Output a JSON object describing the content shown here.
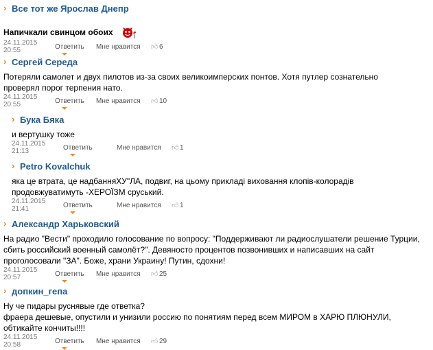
{
  "comments": [
    {
      "author": "Все тот же Ярослав Днепр",
      "text": "Напичкали свинцом обоих",
      "date": "24.11.2015 20:55",
      "reply": "Ответить",
      "like": "Мне нравится",
      "count": "6"
    },
    {
      "author": "Сергей Середа",
      "text": "Потеряли самолет и двух пилотов из-за своих великоимперских понтов. Хотя путлер сознательно проверял порог терпения нато.",
      "date": "24.11.2015 20:55",
      "reply": "Ответить",
      "like": "Мне нравится",
      "count": "10"
    },
    {
      "author": "Бука Бяка",
      "text": "и вертушку тоже",
      "date": "24.11.2015 21:13",
      "reply": "Ответить",
      "like": "Мне нравится",
      "count": "1"
    },
    {
      "author": "Petro Kovalchuk",
      "text": "яка це втрата, це надбанняХУ\"ЛА, подвиг, на цьому прикладі виховання клопів-колорадів продовжуватимуть -ХЕРОЇЗМ сруський.",
      "date": "24.11.2015 21:41",
      "reply": "Ответить",
      "like": "Мне нравится",
      "count": "1"
    },
    {
      "author": "Александр Харьковский",
      "text": "На радио \"Вести\" проходило голосование по вопросу: \"Поддерживают ли радиослушатели решение Турции, сбить российский военный самолёт?\". Девяносто процентов позвонивших и написавших на сайт проголосовали \"ЗА\". Боже, храни Украину! Путин, сдохни!",
      "date": "24.11.2015 20:57",
      "reply": "Ответить",
      "like": "Мне нравится",
      "count": "25"
    },
    {
      "author": "допкин_гепа",
      "text": "Ну че пидары руснявые где ответка?\nфраера дешевые, опустили и унизили россию по понятиям перед всем МИРОМ в ХАРЮ ПЛЮНУЛИ, обтикайте кончиты!!!!",
      "date": "24.11.2015 20:58",
      "reply": "Ответить",
      "like": "Мне нравится",
      "count": "29"
    }
  ]
}
